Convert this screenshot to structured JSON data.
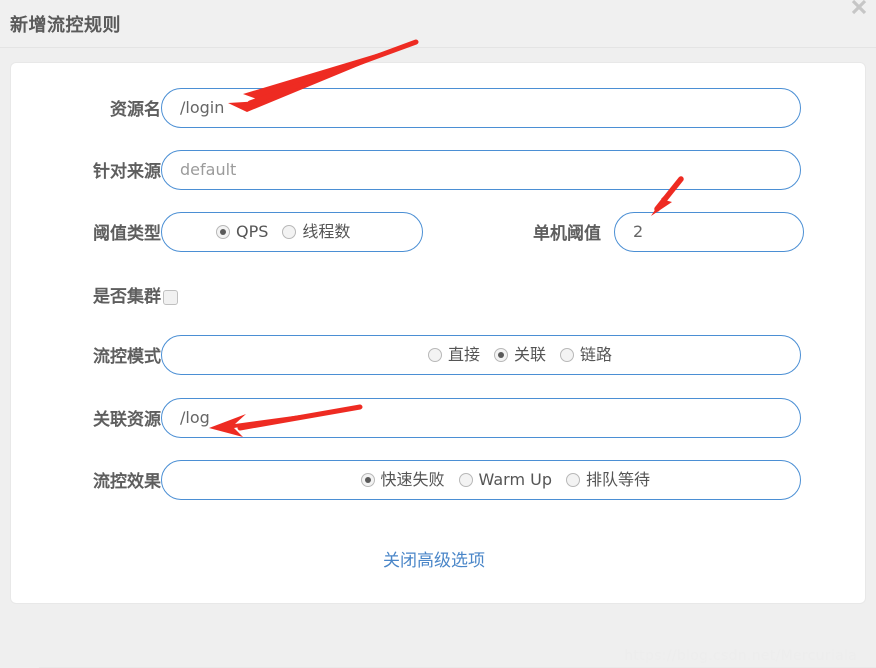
{
  "dialog": {
    "title": "新增流控规则",
    "close_icon": "close-icon"
  },
  "form": {
    "rows": [
      {
        "label": "资源名",
        "type": "text",
        "value": "/login",
        "is_placeholder": false
      },
      {
        "label": "针对来源",
        "type": "text",
        "value": "default",
        "is_placeholder": true
      },
      {
        "label": "阈值类型",
        "type": "radio",
        "options": [
          "QPS",
          "线程数"
        ],
        "selected": "QPS"
      },
      {
        "label": "单机阈值",
        "type": "text",
        "value": "2",
        "is_placeholder": false
      },
      {
        "label": "是否集群",
        "type": "checkbox",
        "checked": false
      },
      {
        "label": "流控模式",
        "type": "radio",
        "options": [
          "直接",
          "关联",
          "链路"
        ],
        "selected": "关联"
      },
      {
        "label": "关联资源",
        "type": "text",
        "value": "/log",
        "is_placeholder": false
      },
      {
        "label": "流控效果",
        "type": "radio",
        "options": [
          "快速失败",
          "Warm Up",
          "排队等待"
        ],
        "selected": "快速失败"
      }
    ],
    "advanced_link": "关闭高级选项"
  },
  "watermark": "https://blog.csdn.net/Mercuriala",
  "colors": {
    "field_border": "#4b8fd4",
    "link": "#4a86c8",
    "header_bg": "#f0f0f0",
    "annotation_arrow": "#ee2b22"
  },
  "annotations": [
    {
      "name": "arrow-to-resource-name"
    },
    {
      "name": "arrow-to-threshold"
    },
    {
      "name": "arrow-to-related-resource"
    }
  ]
}
